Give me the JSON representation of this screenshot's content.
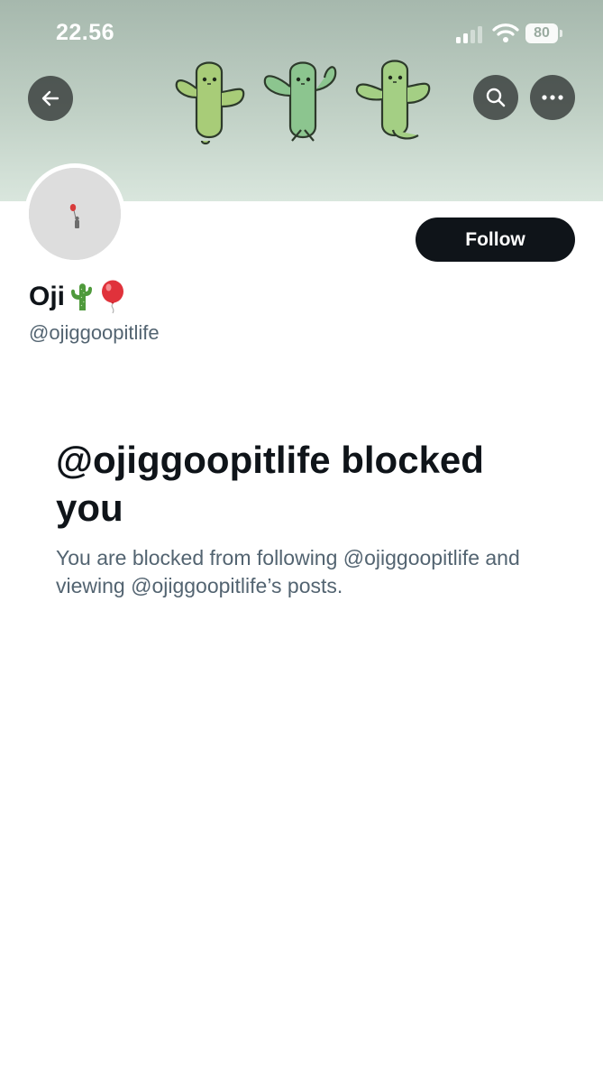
{
  "status_bar": {
    "time": "22.56",
    "battery": "80"
  },
  "header": {
    "banner_icons": [
      "cactus-character",
      "cactus-character",
      "cactus-character"
    ],
    "back_icon": "arrow-left-icon",
    "search_icon": "search-icon",
    "more_icon": "more-horizontal-icon"
  },
  "profile": {
    "display_name": "Oji",
    "name_emojis": [
      "cactus",
      "balloon"
    ],
    "handle": "@ojiggoopitlife",
    "follow_label": "Follow"
  },
  "blocked": {
    "title": "@ojiggoopitlife blocked you",
    "description": "You are blocked from following @ojiggoopitlife and viewing @ojiggoopitlife’s posts."
  },
  "colors": {
    "follow_button_bg": "#0f1419",
    "primary_text": "#0f1419",
    "secondary_text": "#536471",
    "banner_green": "#c0d0c5"
  }
}
